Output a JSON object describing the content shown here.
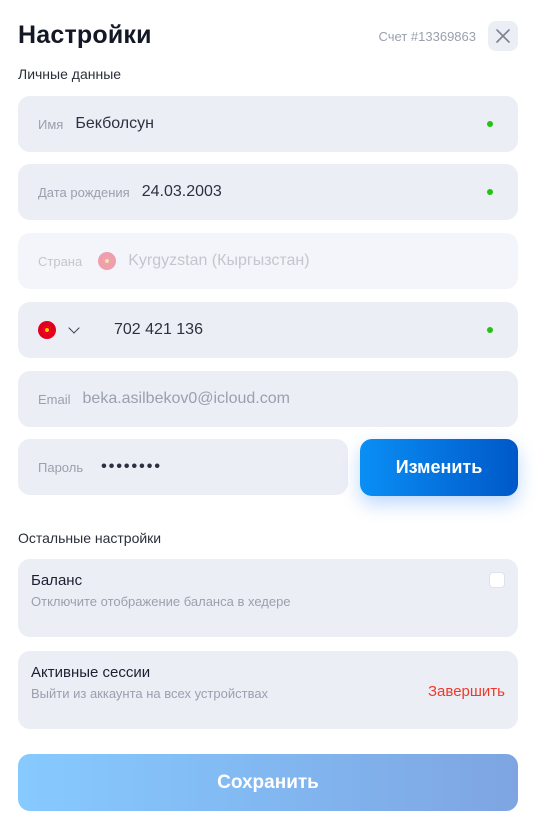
{
  "header": {
    "title": "Настройки",
    "account": "Счет #13369863"
  },
  "personal": {
    "section_label": "Личные данные",
    "name": {
      "label": "Имя",
      "value": "Бекболсун"
    },
    "birthdate": {
      "label": "Дата рождения",
      "value": "24.03.2003"
    },
    "country": {
      "label": "Страна",
      "value": "Kyrgyzstan (Кыргызстан)"
    },
    "phone": {
      "value": "702 421 136"
    },
    "email": {
      "label": "Email",
      "value": "beka.asilbekov0@icloud.com"
    },
    "password": {
      "label": "Пароль",
      "value": "••••••••"
    },
    "change_button": "Изменить"
  },
  "other": {
    "section_label": "Остальные настройки",
    "balance": {
      "title": "Баланс",
      "description": "Отключите отображение баланса в хедере",
      "checked": false
    },
    "sessions": {
      "title": "Активные сессии",
      "description": "Выйти из аккаунта на всех устройствах",
      "action": "Завершить"
    }
  },
  "save_button": "Сохранить",
  "colors": {
    "field_bg": "#eceef6",
    "accent_start": "#0a8ff5",
    "accent_end": "#0058c8",
    "valid_dot": "#22c40f",
    "danger": "#f0382a"
  },
  "icons": {
    "close": "close-icon",
    "country_flag": "kyrgyzstan-flag-icon",
    "dropdown": "chevron-down-icon"
  }
}
